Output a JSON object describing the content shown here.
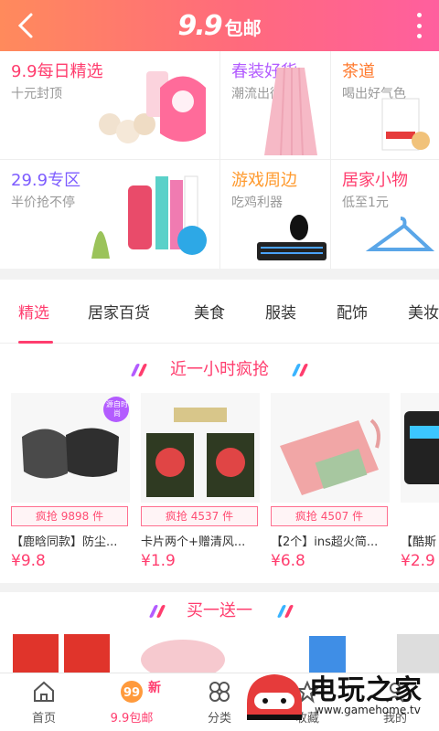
{
  "header": {
    "logo_number": "9.9",
    "logo_text": "包邮",
    "back_icon": "back-chevron-icon",
    "more_icon": "more-vertical-icon"
  },
  "categories": [
    {
      "title": "9.9每日精选",
      "subtitle": "十元封顶",
      "color": "#ff3d6e"
    },
    {
      "title": "春装好货",
      "subtitle": "潮流出街",
      "color": "#b35cff"
    },
    {
      "title": "茶道",
      "subtitle": "喝出好气色",
      "color": "#ff7a2e"
    },
    {
      "title": "29.9专区",
      "subtitle": "半价抢不停",
      "color": "#7d5cff"
    },
    {
      "title": "游戏周边",
      "subtitle": "吃鸡利器",
      "color": "#ff9a2e"
    },
    {
      "title": "居家小物",
      "subtitle": "低至1元",
      "color": "#ff3d6e"
    }
  ],
  "tabs": [
    {
      "label": "精选",
      "active": true
    },
    {
      "label": "居家百货",
      "active": false
    },
    {
      "label": "美食",
      "active": false
    },
    {
      "label": "服装",
      "active": false
    },
    {
      "label": "配饰",
      "active": false
    },
    {
      "label": "美妆",
      "active": false
    }
  ],
  "section1": {
    "title": "近一小时疯抢",
    "products": [
      {
        "badge": "疯抢 9898 件",
        "name": "【鹿晗同款】防尘...",
        "price": "¥9.8",
        "tag": "源自时尚"
      },
      {
        "badge": "疯抢 4537 件",
        "name": "卡片两个+赠清风...",
        "price": "¥1.9"
      },
      {
        "badge": "疯抢 4507 件",
        "name": "【2个】ins超火简...",
        "price": "¥6.8"
      },
      {
        "badge": "",
        "name": "【酷斯",
        "price": "¥2.9"
      }
    ]
  },
  "section2": {
    "title": "买一送一"
  },
  "bottom_nav": [
    {
      "label": "首页",
      "icon": "home-icon"
    },
    {
      "label": "9.9包邮",
      "icon": "nine-nine-icon",
      "active": true,
      "new": "新"
    },
    {
      "label": "分类",
      "icon": "category-icon"
    },
    {
      "label": "收藏",
      "icon": "favorite-icon"
    },
    {
      "label": "我的",
      "icon": "profile-icon"
    }
  ],
  "watermark": {
    "title": "电玩之家",
    "url": "www.gamehome.tv"
  },
  "colors": {
    "accent": "#ff3d6e",
    "header_start": "#ff8a5c",
    "header_end": "#ff5f9e"
  }
}
